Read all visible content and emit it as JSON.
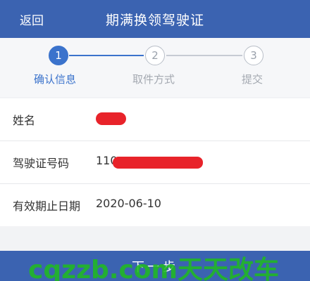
{
  "header": {
    "back_label": "返回",
    "title": "期满换领驾驶证"
  },
  "stepper": {
    "steps": [
      {
        "number": "1",
        "label": "确认信息",
        "state": "active"
      },
      {
        "number": "2",
        "label": "取件方式",
        "state": "pending"
      },
      {
        "number": "3",
        "label": "提交",
        "state": "pending"
      }
    ]
  },
  "info": {
    "rows": [
      {
        "label": "姓名",
        "value": ""
      },
      {
        "label": "驾驶证号码",
        "value": "110"
      },
      {
        "label": "有效期止日期",
        "value": "2020-06-10"
      }
    ]
  },
  "footer": {
    "next_label": "下一步"
  },
  "watermark": {
    "text": "cqzzb.com天天改车"
  },
  "colors": {
    "primary": "#3b63b1",
    "step_active": "#3b73cc",
    "redaction": "#e8232a",
    "watermark": "#20b920"
  }
}
